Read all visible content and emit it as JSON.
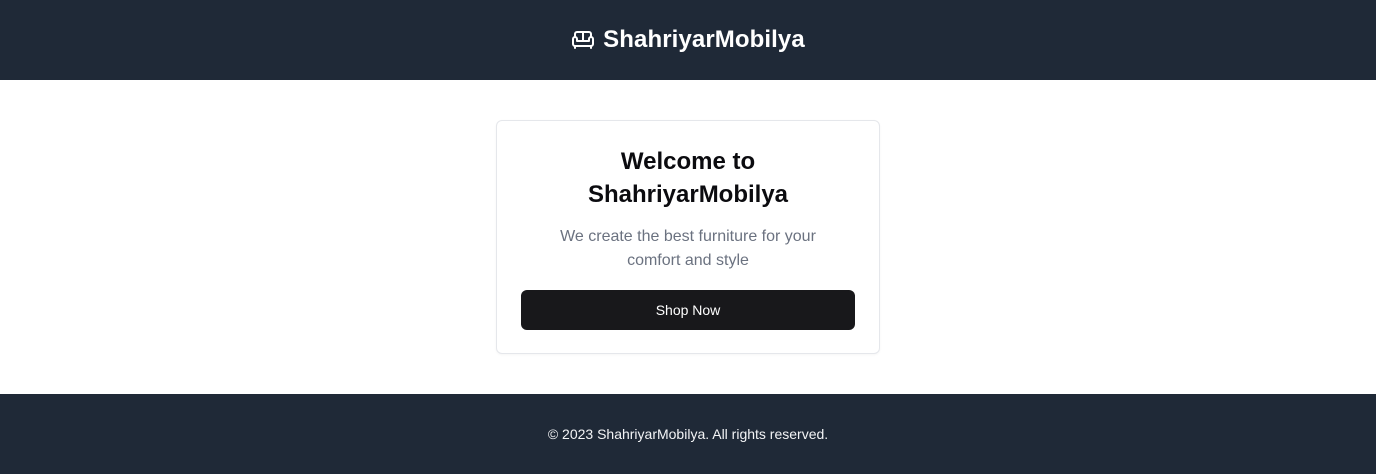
{
  "header": {
    "brand_name": "ShahriyarMobilya",
    "brand_icon": "sofa-icon"
  },
  "hero": {
    "title": "Welcome to ShahriyarMobilya",
    "subtitle": "We create the best furniture for your comfort and style",
    "cta_label": "Shop Now"
  },
  "footer": {
    "copyright": "© 2023 ShahriyarMobilya. All rights reserved."
  },
  "colors": {
    "header_bg": "#1f2937",
    "footer_bg": "#1f2937",
    "button_bg": "#18181b",
    "subtitle_text": "#6b7280",
    "card_border": "#e5e7eb"
  }
}
